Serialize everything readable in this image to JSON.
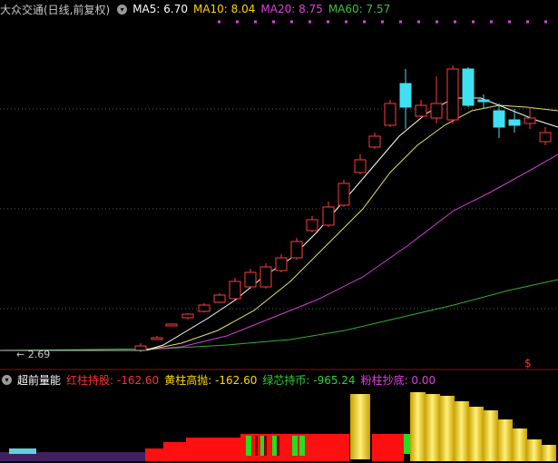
{
  "main": {
    "title": "大众交通(日线,前复权)",
    "ma_labels": [
      {
        "text": "MA5: 6.70",
        "color": "#ffffff"
      },
      {
        "text": "MA10: 8.04",
        "color": "#ffd700"
      },
      {
        "text": "MA20: 8.75",
        "color": "#e040e0"
      },
      {
        "text": "MA60: 7.57",
        "color": "#40c040"
      }
    ],
    "low_marker": "← 2.69",
    "flag": "$"
  },
  "sub": {
    "title": "超前量能",
    "labels": [
      {
        "text": "红柱持股: -162.60",
        "color": "#ff3030"
      },
      {
        "text": "黄柱高抛: -162.60",
        "color": "#ffd700"
      },
      {
        "text": "绿芯持币: -965.24",
        "color": "#30d030"
      },
      {
        "text": "粉柱抄底: 0.00",
        "color": "#e040e0"
      }
    ]
  },
  "colors": {
    "up": "#ff3b3b",
    "down": "#40e0f0",
    "ma5": "#ffffff",
    "ma10": "#e6e060",
    "ma20": "#d040d0",
    "ma60": "#30b030"
  }
}
